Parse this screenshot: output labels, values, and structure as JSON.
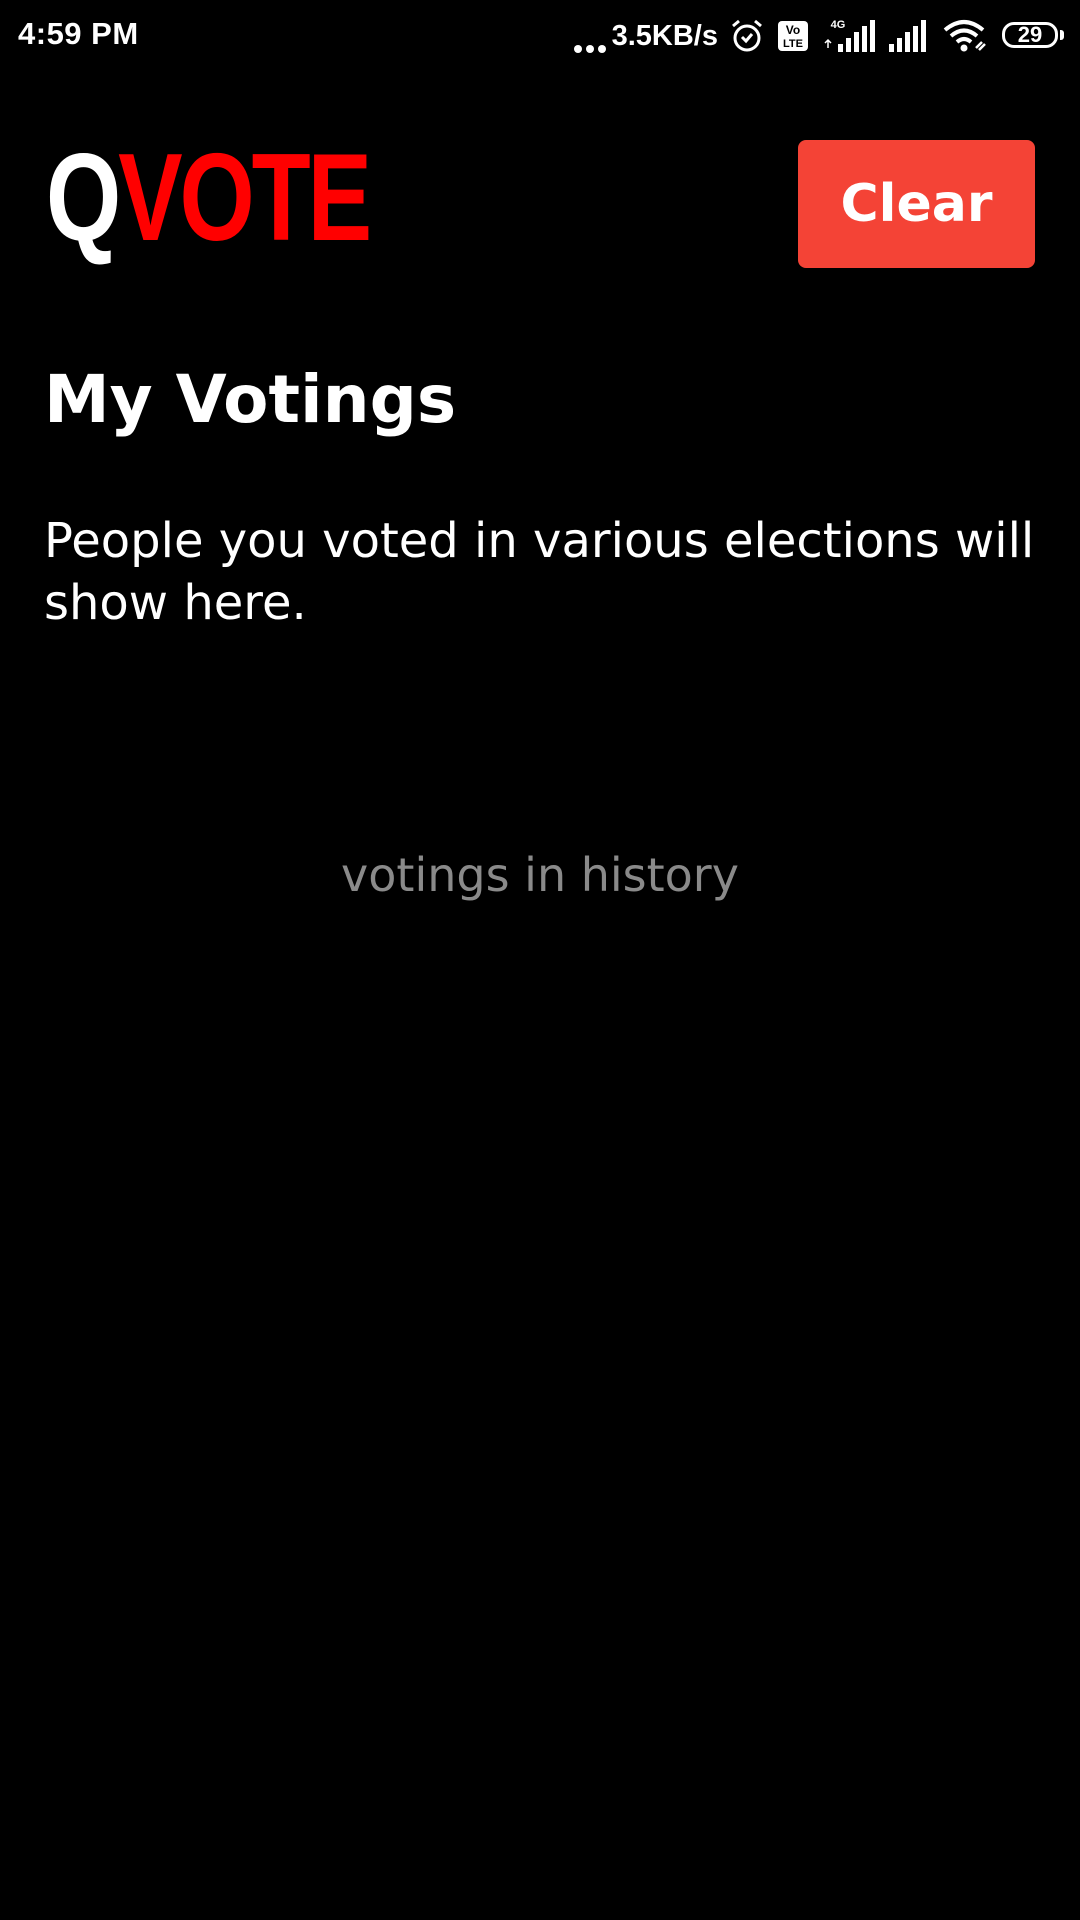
{
  "status_bar": {
    "time": "4:59 PM",
    "net_speed": "3.5KB/s",
    "battery_level": "29",
    "icons": [
      "more-dots-icon",
      "alarm-icon",
      "volte-icon",
      "4g-signal-icon",
      "signal-icon",
      "wifi-icon",
      "battery-icon"
    ]
  },
  "header": {
    "logo_first": "Q",
    "logo_rest": "VOTE",
    "clear_label": "Clear"
  },
  "main": {
    "title": "My Votings",
    "description": "People you voted in various elections will show here.",
    "empty_text": "votings in history"
  },
  "colors": {
    "background": "#000000",
    "accent": "#f44336",
    "logo_red": "#ff0000",
    "muted_text": "#8a8a8a"
  }
}
